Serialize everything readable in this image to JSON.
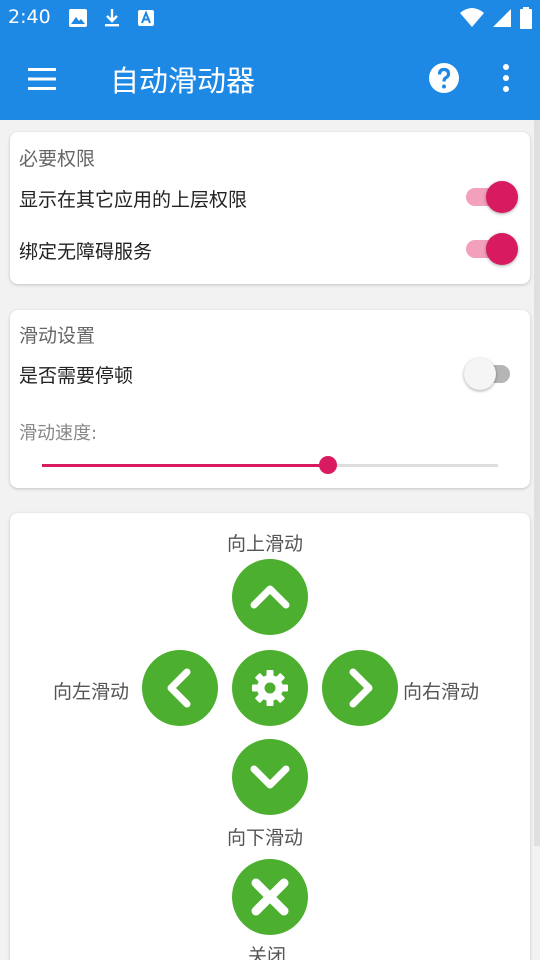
{
  "status": {
    "time": "2:40"
  },
  "appbar": {
    "title": "自动滑动器"
  },
  "permissions": {
    "title": "必要权限",
    "overlay_label": "显示在其它应用的上层权限",
    "overlay_on": true,
    "accessibility_label": "绑定无障碍服务",
    "accessibility_on": true
  },
  "slide_settings": {
    "title": "滑动设置",
    "pause_label": "是否需要停顿",
    "pause_on": false,
    "speed_label": "滑动速度:",
    "speed_fraction": 0.628
  },
  "controls": {
    "up": "向上滑动",
    "down": "向下滑动",
    "left": "向左滑动",
    "right": "向右滑动",
    "close": "关闭"
  },
  "colors": {
    "primary": "#1e88e5",
    "accent": "#d81b60",
    "button": "#4caf2f"
  },
  "icons": [
    "image-icon",
    "download-icon",
    "font-icon",
    "wifi-icon",
    "signal-icon",
    "battery-icon",
    "menu-icon",
    "help-icon",
    "more-vert-icon",
    "chevron-up-icon",
    "chevron-left-icon",
    "gear-icon",
    "chevron-right-icon",
    "chevron-down-icon",
    "close-icon"
  ]
}
